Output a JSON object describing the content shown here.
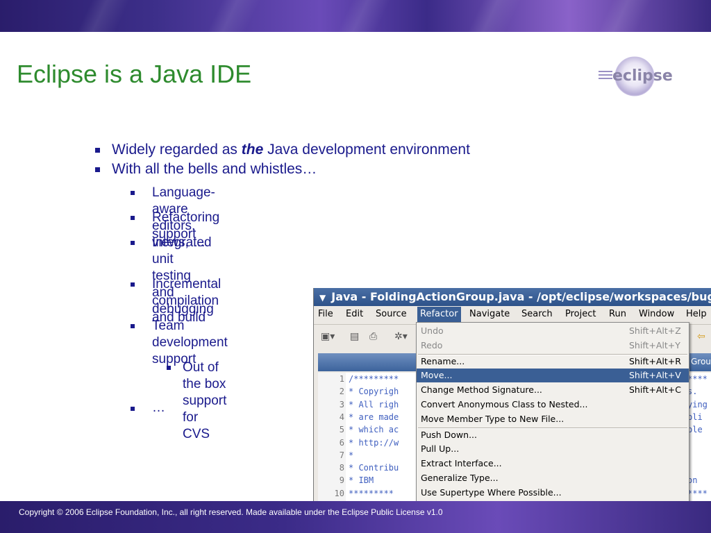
{
  "slide": {
    "title": "Eclipse is a Java IDE",
    "logo_text": "eclipse",
    "footer": "Copyright © 2006 Eclipse Foundation, Inc., all right reserved. Made available under the Eclipse Public License v1.0"
  },
  "bullets": [
    {
      "pre": "Widely regarded as ",
      "em": "the",
      "post": " Java development environment"
    },
    {
      "text": "With all the bells and whistles…"
    }
  ],
  "sub_bullets": [
    {
      "text": "Language-aware editors, views, …"
    },
    {
      "text": "Refactoring support"
    },
    {
      "line1": "Integrated unit testing",
      "line2": "and debugging"
    },
    {
      "line1": "Incremental compilation",
      "line2": "and build"
    },
    {
      "line1": "Team development",
      "line2": "support"
    },
    {
      "text": "…"
    }
  ],
  "sub_sub_bullets": [
    {
      "line1": "Out of the box",
      "line2": "support for CVS"
    }
  ],
  "ide": {
    "window_title": "Java - FoldingActionGroup.java - /opt/eclipse/workspaces/bugt",
    "menu": [
      "File",
      "Edit",
      "Source",
      "Refactor",
      "Navigate",
      "Search",
      "Project",
      "Run",
      "Window",
      "Help"
    ],
    "active_menu": "Refactor",
    "editor_tab_text": "Grou",
    "refactor_menu": [
      {
        "label": "Undo",
        "shortcut": "Shift+Alt+Z",
        "disabled": true
      },
      {
        "label": "Redo",
        "shortcut": "Shift+Alt+Y",
        "disabled": true
      },
      {
        "label": "Rename...",
        "shortcut": "Shift+Alt+R"
      },
      {
        "label": "Move...",
        "shortcut": "Shift+Alt+V",
        "selected": true
      },
      {
        "label": "Change Method Signature...",
        "shortcut": "Shift+Alt+C"
      },
      {
        "label": "Convert Anonymous Class to Nested...",
        "shortcut": ""
      },
      {
        "label": "Move Member Type to New File...",
        "shortcut": ""
      },
      {
        "label": "Push Down...",
        "shortcut": ""
      },
      {
        "label": "Pull Up...",
        "shortcut": ""
      },
      {
        "label": "Extract Interface...",
        "shortcut": ""
      },
      {
        "label": "Generalize Type...",
        "shortcut": ""
      },
      {
        "label": "Use Supertype Where Possible...",
        "shortcut": ""
      }
    ],
    "code_lines": [
      {
        "n": "1",
        "left": "/*********",
        "right": "****"
      },
      {
        "n": "2",
        "left": " * Copyrigh",
        "right": "s."
      },
      {
        "n": "3",
        "left": " * All righ",
        "right": "ying"
      },
      {
        "n": "4",
        "left": " * are made",
        "right": "bli"
      },
      {
        "n": "5",
        "left": " * which ac",
        "right": "ble"
      },
      {
        "n": "6",
        "left": " * http://w",
        "right": ""
      },
      {
        "n": "7",
        "left": " *",
        "right": ""
      },
      {
        "n": "8",
        "left": " * Contribu",
        "right": ""
      },
      {
        "n": "9",
        "left": " *     IBM",
        "right": "on"
      },
      {
        "n": "10",
        "left": " *********",
        "right": "****"
      }
    ]
  }
}
